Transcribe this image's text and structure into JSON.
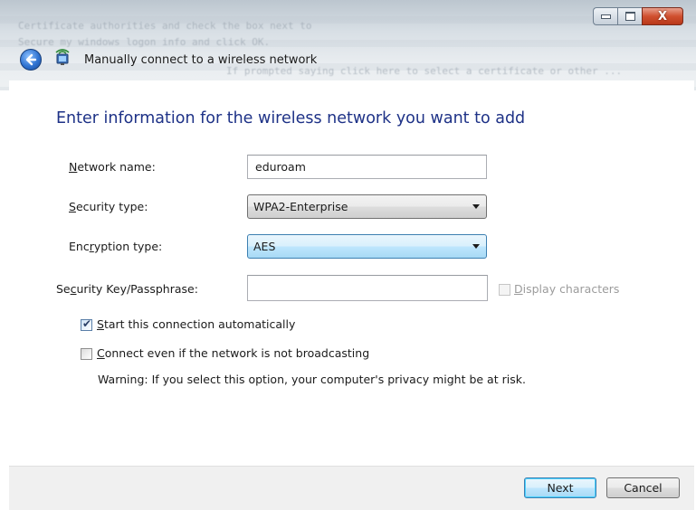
{
  "window": {
    "title": "Manually connect to a wireless network",
    "background_lines": [
      "Certificate authorities and check the box next to",
      "Secure my windows logon info and click OK.",
      "If prompted saying click here to select a certificate or other ..."
    ],
    "controls": {
      "minimize": "minimize",
      "maximize": "maximize",
      "close": "X"
    }
  },
  "main": {
    "heading": "Enter information for the wireless network you want to add",
    "network_name": {
      "pre": "",
      "key": "N",
      "post": "etwork name:",
      "value": "eduroam"
    },
    "security_type": {
      "pre": "",
      "key": "S",
      "post": "ecurity type:",
      "value": "WPA2-Enterprise"
    },
    "encryption_type": {
      "pre": "Enc",
      "key": "r",
      "post": "yption type:",
      "value": "AES"
    },
    "security_key": {
      "pre": "Se",
      "key": "c",
      "post": "urity Key/Passphrase:",
      "value": ""
    },
    "display_characters": {
      "pre": "",
      "key": "D",
      "post": "isplay characters",
      "checked": false,
      "enabled": false
    },
    "start_auto": {
      "pre": "",
      "key": "S",
      "post": "tart this connection automatically",
      "checked": true
    },
    "connect_broadcast": {
      "pre": "",
      "key": "C",
      "post": "onnect even if the network is not broadcasting",
      "checked": false
    },
    "warning": "Warning: If you select this option, your computer's privacy might be at risk."
  },
  "footer": {
    "next": "Next",
    "cancel": "Cancel"
  },
  "colors": {
    "heading": "#1e3287",
    "accent": "#3c7fb1"
  }
}
